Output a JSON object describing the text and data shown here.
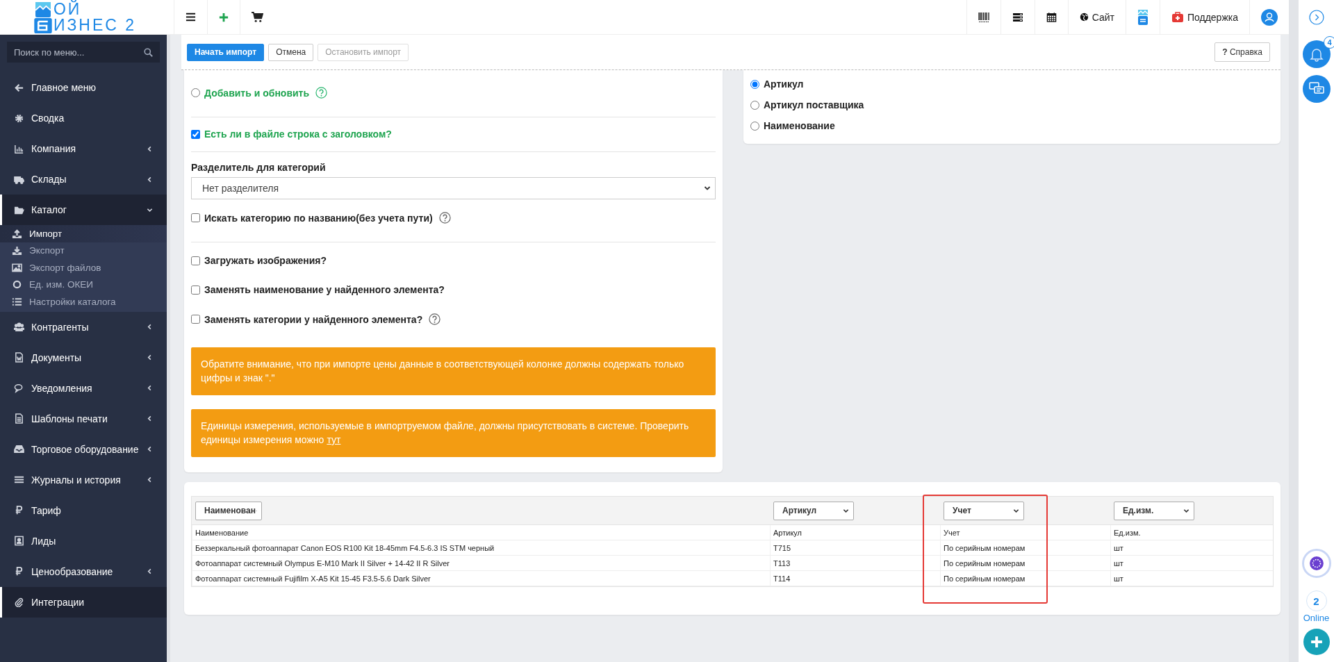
{
  "topbar": {
    "logo": {
      "line1": "ОЙ",
      "line2": "ИЗНЕС 2"
    },
    "site_link": "Сайт",
    "support_link": "Поддержка"
  },
  "sidebar": {
    "search": {
      "placeholder": "Поиск по меню..."
    },
    "items": [
      {
        "label": "Главное меню",
        "submenu": false,
        "active": false
      },
      {
        "label": "Сводка",
        "submenu": false,
        "active": false
      },
      {
        "label": "Компания",
        "submenu": true,
        "expanded": false,
        "active": false
      },
      {
        "label": "Склады",
        "submenu": true,
        "expanded": false,
        "active": false
      },
      {
        "label": "Каталог",
        "submenu": true,
        "expanded": true,
        "active": true,
        "children": [
          {
            "label": "Импорт",
            "selected": true
          },
          {
            "label": "Экспорт",
            "selected": false
          },
          {
            "label": "Экспорт файлов",
            "selected": false
          },
          {
            "label": "Ед. изм. ОКЕИ",
            "selected": false
          },
          {
            "label": "Настройки каталога",
            "selected": false
          }
        ]
      },
      {
        "label": "Контрагенты",
        "submenu": true,
        "expanded": false,
        "active": false
      },
      {
        "label": "Документы",
        "submenu": true,
        "expanded": false,
        "active": false
      },
      {
        "label": "Уведомления",
        "submenu": true,
        "expanded": false,
        "active": false
      },
      {
        "label": "Шаблоны печати",
        "submenu": true,
        "expanded": false,
        "active": false
      },
      {
        "label": "Торговое оборудование",
        "submenu": true,
        "expanded": false,
        "active": false
      },
      {
        "label": "Журналы и история",
        "submenu": true,
        "expanded": false,
        "active": false
      },
      {
        "label": "Тариф",
        "submenu": false,
        "active": false
      },
      {
        "label": "Лиды",
        "submenu": false,
        "active": false
      },
      {
        "label": "Ценообразование",
        "submenu": true,
        "expanded": false,
        "active": false
      },
      {
        "label": "Интеграции",
        "submenu": false,
        "active": true
      }
    ]
  },
  "toolbar": {
    "buttons": [
      {
        "label": "Начать импорт",
        "primary": true,
        "disabled": false
      },
      {
        "label": "Отмена",
        "primary": false,
        "disabled": false
      },
      {
        "label": "Остановить импорт",
        "primary": false,
        "disabled": true
      }
    ],
    "help_button": {
      "icon": "?",
      "label": "Справка"
    }
  },
  "import_form": {
    "groups": [
      [
        {
          "kind": "radio",
          "label": "Добавить и обновить",
          "selected": false,
          "accent": true,
          "help": true
        }
      ],
      [
        {
          "kind": "checkbox",
          "label": "Есть ли в файле строка с заголовком?",
          "checked": true,
          "accent": true,
          "help": false
        }
      ],
      [
        {
          "kind": "select",
          "label": "Разделитель для категорий",
          "value": "Нет разделителя"
        },
        {
          "kind": "checkbox",
          "label": "Искать категорию по названию(без учета пути)",
          "checked": false,
          "accent": false,
          "help": true
        }
      ],
      [
        {
          "kind": "checkbox",
          "label": "Загружать изображения?",
          "checked": false,
          "accent": false,
          "help": false
        },
        {
          "kind": "checkbox",
          "label": "Заменять наименование у найденного элемента?",
          "checked": false,
          "accent": false,
          "help": false
        },
        {
          "kind": "checkbox",
          "label": "Заменять категории у найденного элемента?",
          "checked": false,
          "accent": false,
          "help": true
        }
      ]
    ]
  },
  "notices": [
    {
      "text": "Обратите внимание, что при импорте цены данные в соответствующей колонке должны содержать только цифры и знак \".\""
    },
    {
      "text": "Единицы измерения, используемые в импортруемом файле, должны присутствовать в системе. Проверить единицы измерения можно",
      "link": "тут"
    }
  ],
  "match_by": [
    {
      "label": "Артикул",
      "selected": true
    },
    {
      "label": "Артикул поставщика",
      "selected": false
    },
    {
      "label": "Наименование",
      "selected": false
    }
  ],
  "table": {
    "columns": [
      {
        "selector": "Наименован",
        "label": "Наименование",
        "highlighted": false
      },
      {
        "selector": "Артикул",
        "label": "Артикул",
        "highlighted": false
      },
      {
        "selector": "Учет",
        "label": "Учет",
        "highlighted": true
      },
      {
        "selector": "Ед.изм.",
        "label": "Ед.изм.",
        "highlighted": false
      }
    ],
    "rows": [
      [
        "Беззеркальный фотоаппарат Canon EOS R100 Kit 18-45mm F4.5-6.3 IS STM черный",
        "T715",
        "По серийным номерам",
        "шт"
      ],
      [
        "Фотоаппарат системный Olympus E-M10 Mark II Silver + 14-42 II R Silver",
        "T113",
        "По серийным номерам",
        "шт"
      ],
      [
        "Фотоаппарат системный Fujifilm X-A5 Kit 15-45 F3.5-5.6 Dark Silver",
        "T114",
        "По серийным номерам",
        "шт"
      ]
    ]
  },
  "right_rail": {
    "notification_count": "4",
    "online_count": "2",
    "online_label": "Online"
  }
}
